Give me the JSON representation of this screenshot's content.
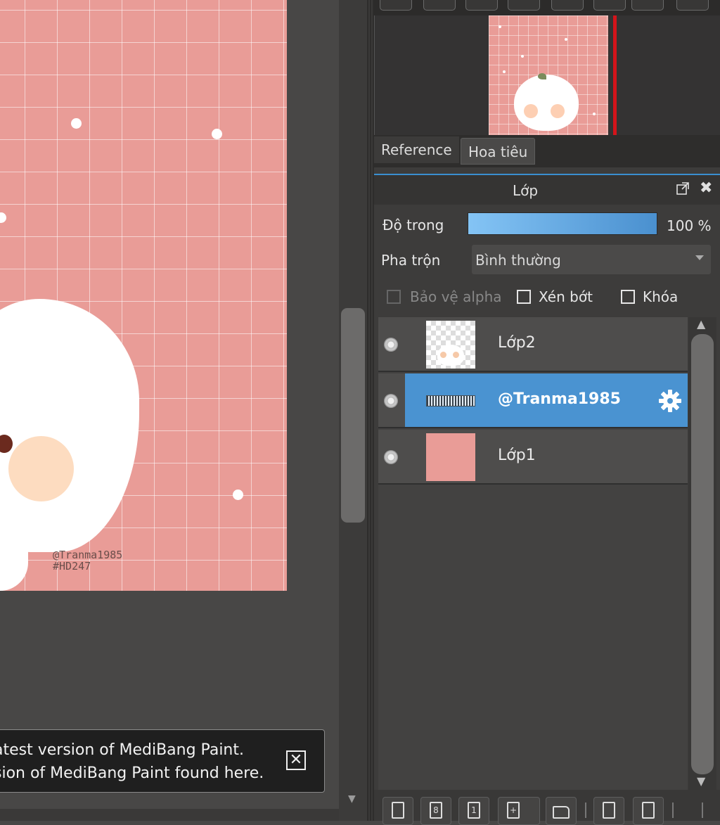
{
  "canvas": {
    "signature_line_1": "@Tranma1985",
    "signature_line_2": "#HD247"
  },
  "notification": {
    "line_1": "atest version of MediBang Paint.",
    "line_2": "sion of MediBang Paint found here.",
    "close_glyph": "✕"
  },
  "panel_tabs": {
    "reference": "Reference",
    "navigator": "Hoa tiêu"
  },
  "layer_panel": {
    "title": "Lớp",
    "opacity_label": "Độ trong",
    "opacity_value": "100 %",
    "opacity_percent": 100,
    "blend_label": "Pha trộn",
    "blend_value": "Bình thường",
    "alpha_protect_label": "Bảo vệ alpha",
    "clipping_label": "Xén bớt",
    "lock_label": "Khóa",
    "close_glyph": "✖",
    "layers": [
      {
        "name": "Lớp2",
        "thumbnail": "transparent-mascot",
        "visible": true,
        "selected": false
      },
      {
        "name": "@Tranma1985",
        "thumbnail": "text",
        "visible": true,
        "selected": true
      },
      {
        "name": "Lớp1",
        "thumbnail": "pink-fill",
        "visible": true,
        "selected": false
      }
    ]
  },
  "colors": {
    "canvas_pink": "#e99c97",
    "selection_blue": "#4a93d1",
    "navigator_frame_red": "#d4141a",
    "tab_accent_blue": "#3a8fd0"
  },
  "icons": {
    "layer_toolbar": [
      "new-layer-icon",
      "new-8bit-layer-icon",
      "new-1bit-layer-icon",
      "add-layer-menu-icon",
      "new-folder-icon",
      "duplicate-layer-icon",
      "merge-down-icon"
    ]
  }
}
